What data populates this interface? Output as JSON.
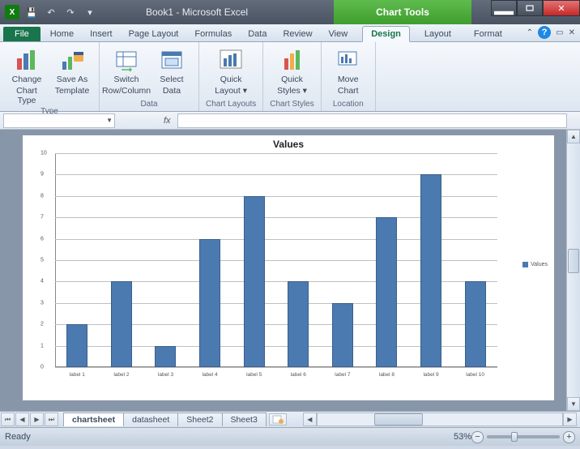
{
  "titlebar": {
    "title": "Book1  -  Microsoft Excel",
    "chart_tools": "Chart Tools"
  },
  "tabs": {
    "file": "File",
    "items": [
      "Home",
      "Insert",
      "Page Layout",
      "Formulas",
      "Data",
      "Review",
      "View"
    ],
    "context": [
      "Design",
      "Layout",
      "Format"
    ],
    "active_context": 0
  },
  "ribbon": {
    "groups": [
      {
        "label": "Type",
        "buttons": [
          {
            "line1": "Change",
            "line2": "Chart Type"
          },
          {
            "line1": "Save As",
            "line2": "Template"
          }
        ]
      },
      {
        "label": "Data",
        "buttons": [
          {
            "line1": "Switch",
            "line2": "Row/Column"
          },
          {
            "line1": "Select",
            "line2": "Data"
          }
        ]
      },
      {
        "label": "Chart Layouts",
        "buttons": [
          {
            "line1": "Quick",
            "line2": "Layout ▾"
          }
        ]
      },
      {
        "label": "Chart Styles",
        "buttons": [
          {
            "line1": "Quick",
            "line2": "Styles ▾"
          }
        ]
      },
      {
        "label": "Location",
        "buttons": [
          {
            "line1": "Move",
            "line2": "Chart"
          }
        ]
      }
    ]
  },
  "formula_bar": {
    "name_box": "",
    "fx": "fx",
    "formula": ""
  },
  "chart_data": {
    "type": "bar",
    "title": "Values",
    "categories": [
      "label 1",
      "label 2",
      "label 3",
      "label 4",
      "label 5",
      "label 6",
      "label 7",
      "label 8",
      "label 9",
      "label 10"
    ],
    "values": [
      2,
      4,
      1,
      6,
      8,
      4,
      3,
      7,
      9,
      4
    ],
    "series_name": "Values",
    "ylabel": "",
    "xlabel": "",
    "ylim": [
      0,
      10
    ],
    "yticks": [
      0,
      1,
      2,
      3,
      4,
      5,
      6,
      7,
      8,
      9,
      10
    ]
  },
  "sheets": {
    "active": 0,
    "names": [
      "chartsheet",
      "datasheet",
      "Sheet2",
      "Sheet3"
    ]
  },
  "status": {
    "text": "Ready",
    "zoom": "53%"
  }
}
